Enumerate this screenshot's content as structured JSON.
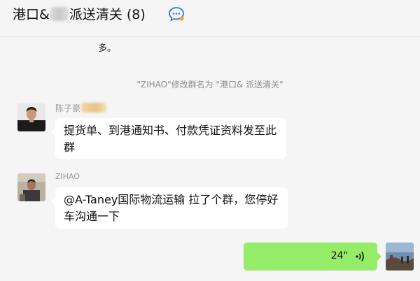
{
  "header": {
    "title_prefix": "港口&",
    "title_suffix": "派送清关",
    "member_count": "(8)"
  },
  "messages": {
    "previous_text": "多。",
    "system_notice": "\"ZIHAO\"修改群名为 \"港口&  派送清关\"",
    "msg1": {
      "sender": "陈子豪",
      "line1": "提货单、到港通知书、付款凭证资料发至此",
      "line2": "群"
    },
    "msg2": {
      "sender": "ZIHAO",
      "line1": "@A-Taney国际物流运输 拉了个群，您停好",
      "line2": "车沟通一下"
    },
    "voice": {
      "duration": "24\""
    }
  },
  "icons": {
    "chat": "chat-bubble-icon",
    "voice": "voice-wave-icon"
  },
  "colors": {
    "background": "#f5f5f5",
    "bubble_self": "#95ec69",
    "bubble_other": "#ffffff",
    "icon_accent": "#2b7be4"
  }
}
